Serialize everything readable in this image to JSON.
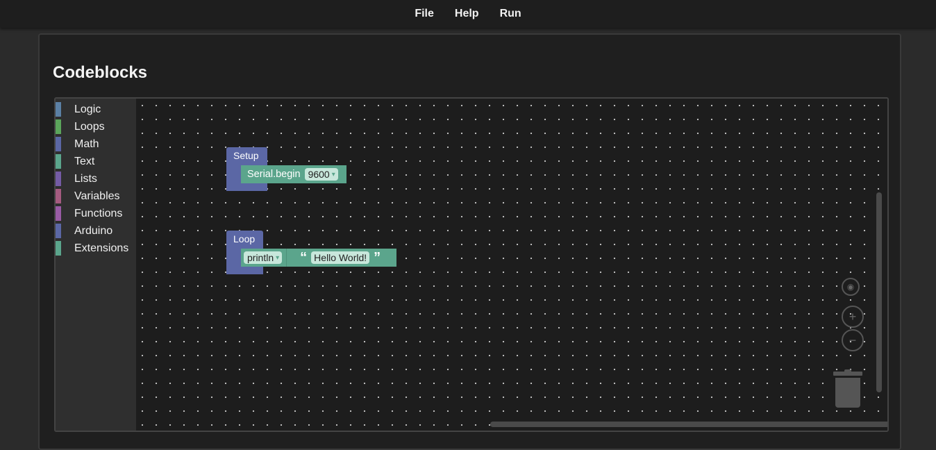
{
  "menubar": {
    "items": [
      {
        "label": "File"
      },
      {
        "label": "Help"
      },
      {
        "label": "Run"
      }
    ]
  },
  "panel": {
    "title": "Codeblocks"
  },
  "toolbox": {
    "items": [
      {
        "label": "Logic",
        "color": "#5b80a5"
      },
      {
        "label": "Loops",
        "color": "#5ba55b"
      },
      {
        "label": "Math",
        "color": "#5b67a5"
      },
      {
        "label": "Text",
        "color": "#5ba58c"
      },
      {
        "label": "Lists",
        "color": "#745ba5"
      },
      {
        "label": "Variables",
        "color": "#a55b80"
      },
      {
        "label": "Functions",
        "color": "#995ba5"
      },
      {
        "label": "Arduino",
        "color": "#5b67a5"
      },
      {
        "label": "Extensions",
        "color": "#5ba58c"
      }
    ]
  },
  "blocks": {
    "setup": {
      "label": "Setup",
      "statement_label": "Serial.begin",
      "baud_value": "9600"
    },
    "loop": {
      "label": "Loop",
      "statement_label": "println",
      "string_value": "Hello World!"
    }
  },
  "glyphs": {
    "dropdown_arrow": "▾",
    "open_quote": "“",
    "close_quote": "”",
    "zoom_in": "+",
    "zoom_out": "−",
    "recenter": "◉"
  },
  "colors": {
    "hat_block": "#5b67a5",
    "text_block": "#5ba58c"
  }
}
